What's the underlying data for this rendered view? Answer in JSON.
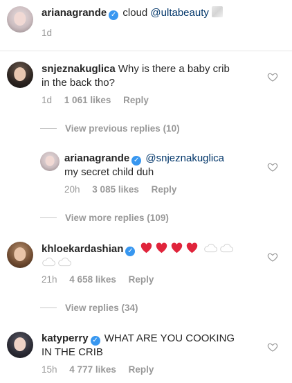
{
  "post": {
    "username": "arianagrande",
    "caption_text": "cloud",
    "caption_mention": "@ultabeauty",
    "time": "1d"
  },
  "comments": [
    {
      "username": "snjeznakuglica",
      "text_line1": "Why is there a baby crib",
      "text_line2": "in the back tho?",
      "time": "1d",
      "likes": "1 061 likes",
      "reply_label": "Reply",
      "thread_label": "View previous replies (10)",
      "reply": {
        "username": "arianagrande",
        "mention": "@snjeznakuglica",
        "text": "my secret child duh",
        "time": "20h",
        "likes": "3 085 likes",
        "reply_label": "Reply"
      },
      "more_label": "View more replies (109)"
    },
    {
      "username": "khloekardashian",
      "time": "21h",
      "likes": "4 658 likes",
      "reply_label": "Reply",
      "thread_label": "View replies (34)"
    },
    {
      "username": "katyperry",
      "text_line1": "WHAT ARE YOU COOKING",
      "text_line2": "IN THE CRIB",
      "time": "15h",
      "likes": "4 777 likes",
      "reply_label": "Reply"
    }
  ],
  "icons": {
    "verified": "verified-badge-icon",
    "like": "heart-outline-icon",
    "red_heart": "red-heart-emoji",
    "cloud": "cloud-emoji"
  },
  "colors": {
    "verified_blue": "#3897f0",
    "mention_blue": "#003569",
    "meta_gray": "#999999",
    "emoji_red": "#e0243b"
  }
}
